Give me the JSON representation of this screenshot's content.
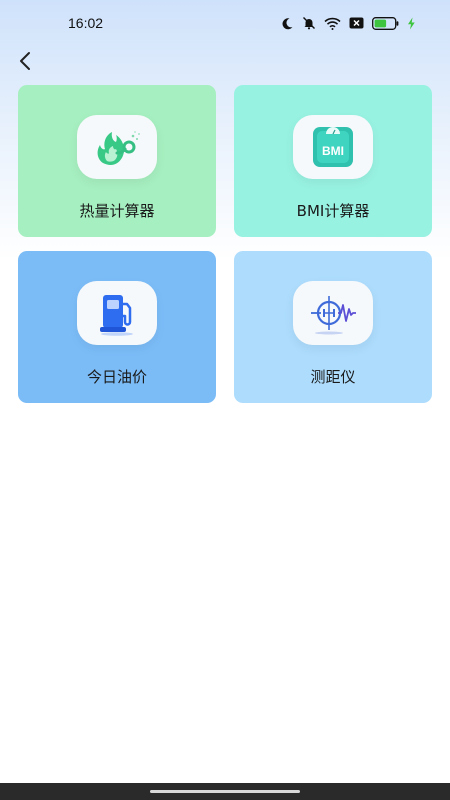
{
  "status_bar": {
    "time": "16:02",
    "icons": [
      "moon-icon",
      "bell-off-icon",
      "wifi-icon",
      "x-box-icon",
      "battery-icon",
      "charging-icon"
    ],
    "battery_color": "#3ec43e"
  },
  "header": {
    "back_icon": "chevron-left-icon"
  },
  "tools": [
    {
      "label": "热量计算器",
      "icon": "flame-calorie-icon",
      "color": "#a6efc0"
    },
    {
      "label": "BMI计算器",
      "icon": "bmi-scale-icon",
      "icon_text": "BMI",
      "color": "#98f2e2"
    },
    {
      "label": "今日油价",
      "icon": "fuel-pump-icon",
      "color": "#7bbcf7"
    },
    {
      "label": "测距仪",
      "icon": "rangefinder-icon",
      "color": "#addcfd"
    }
  ]
}
